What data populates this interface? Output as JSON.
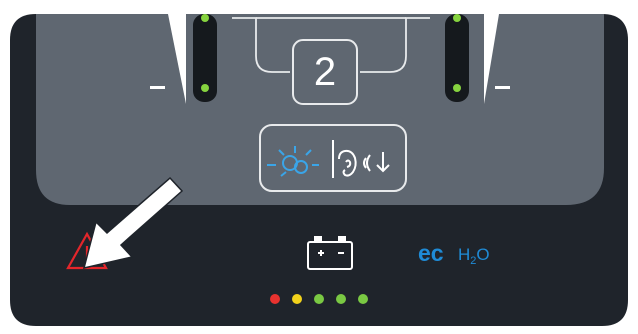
{
  "zone_display": {
    "value": "2"
  },
  "ec_h2o": {
    "ec": "ec",
    "h": "H",
    "sub": "2",
    "o": "O"
  },
  "mode_icons": [
    "light-sensor-icon",
    "ear-sound-down-icon"
  ],
  "status_icons": [
    "warning-triangle-icon",
    "battery-icon"
  ],
  "indicator_lights": [
    {
      "name": "red",
      "color": "#e8322f"
    },
    {
      "name": "yellow",
      "color": "#f2d21b"
    },
    {
      "name": "green",
      "color": "#7ac943"
    },
    {
      "name": "green",
      "color": "#7ac943"
    },
    {
      "name": "green",
      "color": "#7ac943"
    }
  ],
  "colors": {
    "panel_dark": "#1f242b",
    "panel_gray": "#5f6771",
    "warning_red": "#e3262b",
    "brand_blue": "#1f8bd6",
    "led_green": "#86d33f"
  }
}
